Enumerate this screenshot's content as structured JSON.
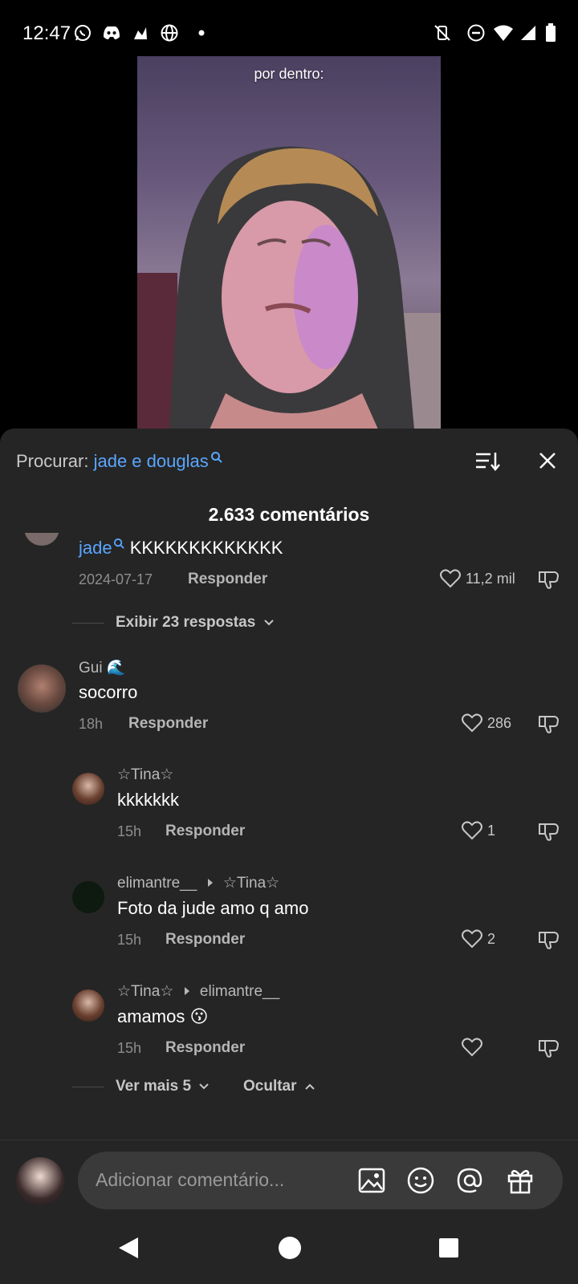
{
  "status_bar": {
    "time": "12:47"
  },
  "video": {
    "caption": "por dentro:"
  },
  "comments_panel": {
    "search_prefix": "Procurar: ",
    "search_term": "jade e douglas",
    "count_label": "2.633 comentários"
  },
  "comments": [
    {
      "username": "jade",
      "text": " KKKKKKKKKKKKK",
      "date": "2024-07-17",
      "reply_label": "Responder",
      "likes": "11,2 mil"
    },
    {
      "username": "Gui 🌊",
      "text": "socorro",
      "date": "18h",
      "reply_label": "Responder",
      "likes": "286"
    }
  ],
  "expand_first": "Exibir 23 respostas",
  "replies": [
    {
      "username": "☆Tina☆",
      "reply_to": "",
      "text": "kkkkkkk",
      "date": "15h",
      "reply_label": "Responder",
      "likes": "1"
    },
    {
      "username": "elimantre__",
      "reply_to": "☆Tina☆",
      "text": "Foto da jude amo q amo",
      "date": "15h",
      "reply_label": "Responder",
      "likes": "2"
    },
    {
      "username": "☆Tina☆",
      "reply_to": "elimantre__",
      "text": "amamos 😗",
      "date": "15h",
      "reply_label": "Responder",
      "likes": ""
    }
  ],
  "see_more": "Ver mais 5",
  "hide": "Ocultar",
  "input": {
    "placeholder": "Adicionar comentário..."
  },
  "colors": {
    "accent": "#5aa6ff",
    "sheet_bg": "#252525"
  }
}
